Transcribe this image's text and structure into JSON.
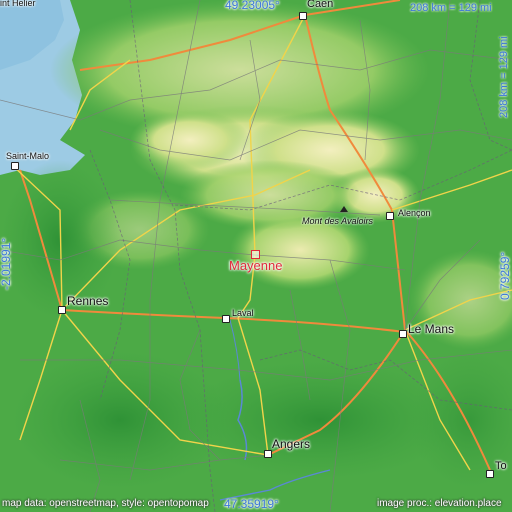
{
  "map": {
    "target_city": "Mayenne",
    "cities": [
      {
        "name": "Caen",
        "id": "caen"
      },
      {
        "name": "Saint-Malo",
        "id": "saint-malo"
      },
      {
        "name": "Rennes",
        "id": "rennes"
      },
      {
        "name": "Laval",
        "id": "laval"
      },
      {
        "name": "Le Mans",
        "id": "le-mans"
      },
      {
        "name": "Angers",
        "id": "angers"
      },
      {
        "name": "Alençon",
        "id": "alencon"
      },
      {
        "name": "int Helier",
        "id": "saint-helier"
      },
      {
        "name": "To",
        "id": "tours"
      }
    ],
    "peak": "Mont des Avaloirs",
    "coords": {
      "north": "49.23005°",
      "south": "47.35919°",
      "west": "-2.01991°",
      "east": "0.79259°"
    },
    "scale": {
      "horizontal": "208 km = 129 mi",
      "vertical": "208 km = 129 mi"
    },
    "credits": {
      "left": "map data: openstreetmap, style: opentopomap",
      "right": "image proc.: elevation.place"
    },
    "colors": {
      "sea": "#9dcbe4",
      "lowland": "#4caa46",
      "highland": "#f3f0b8",
      "accent": "#3c78d8",
      "target": "#e02a3a"
    }
  }
}
